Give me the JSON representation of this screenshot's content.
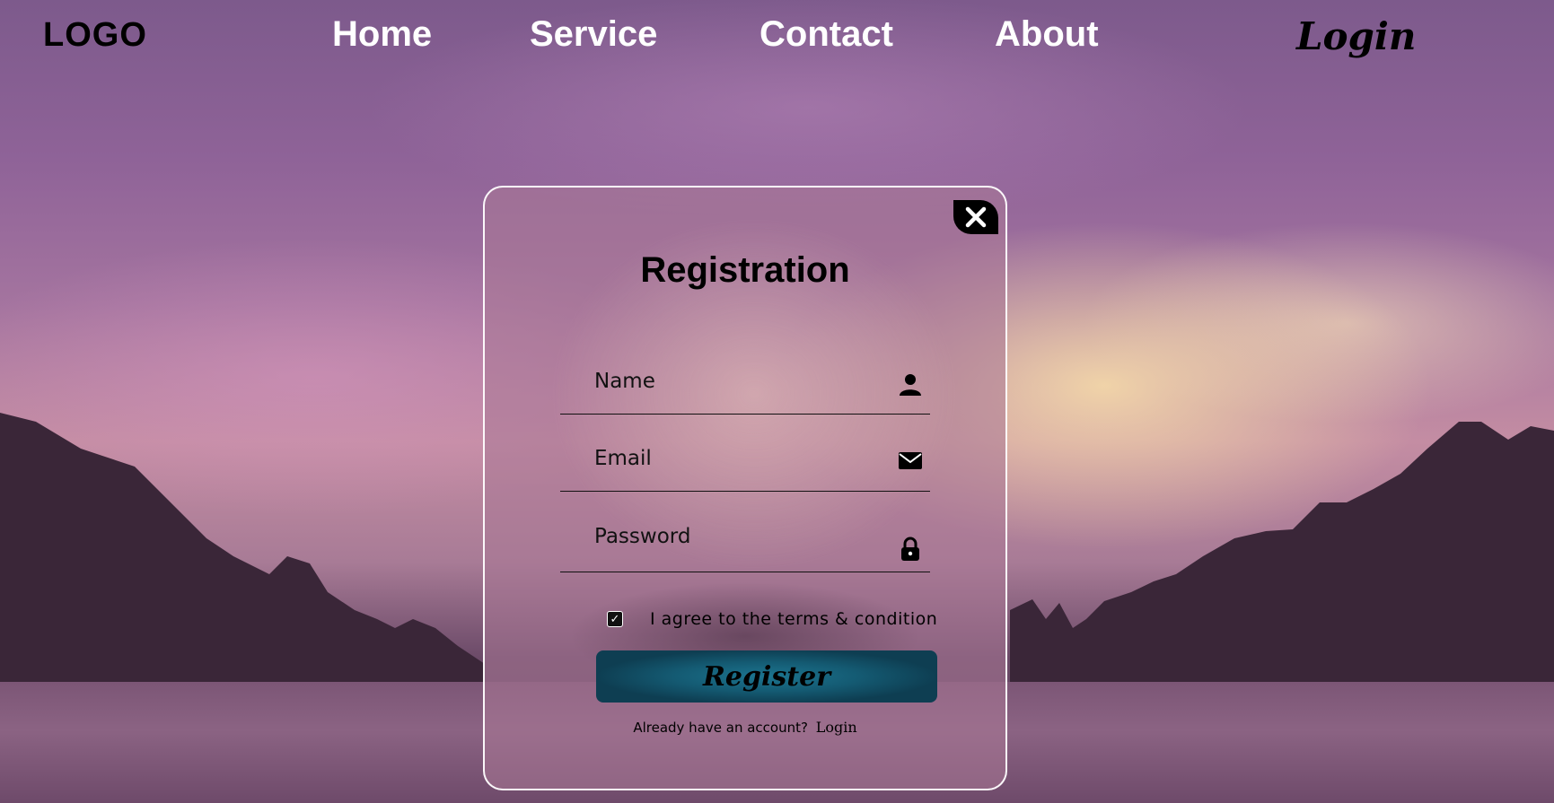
{
  "nav": {
    "logo": "LOGO",
    "links": [
      "Home",
      "Service",
      "Contact",
      "About"
    ],
    "login": "Login"
  },
  "modal": {
    "title": "Registration",
    "close_icon": "close-icon",
    "fields": {
      "name": {
        "placeholder": "Name",
        "value": "",
        "icon": "user-icon"
      },
      "email": {
        "placeholder": "Email",
        "value": "",
        "icon": "mail-icon"
      },
      "password": {
        "placeholder": "Password",
        "value": "",
        "icon": "lock-icon"
      }
    },
    "agree_text": "I agree to the terms & condition",
    "agree_checked": true,
    "register_label": "Register",
    "footer_text": "Already have an account?",
    "footer_login": "Login"
  },
  "colors": {
    "button": "#145a72",
    "text": "#000000",
    "nav_text": "#ffffff"
  }
}
